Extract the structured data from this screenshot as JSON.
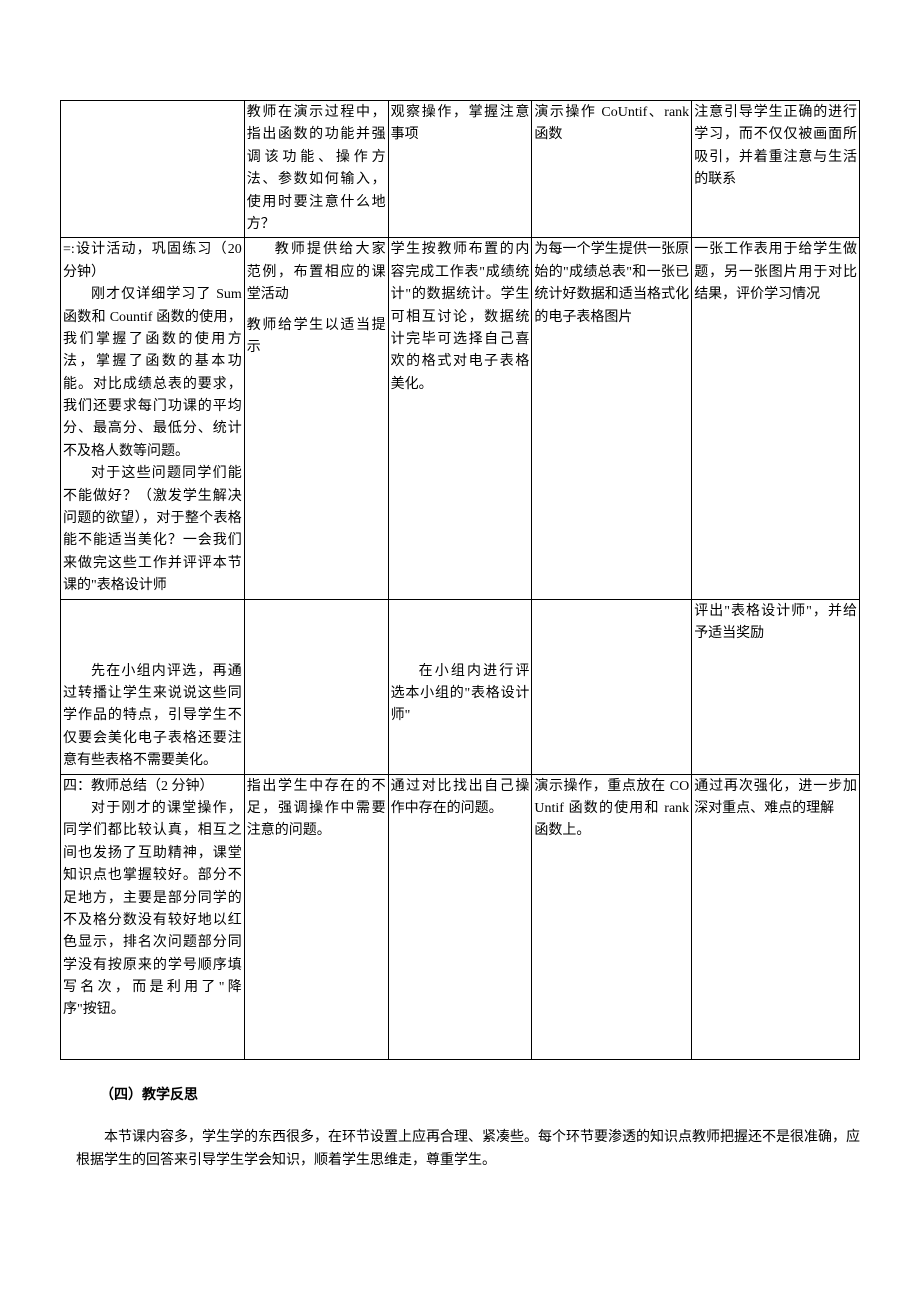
{
  "table": {
    "row1": {
      "c1": "",
      "c2": "教师在演示过程中，指出函数的功能并强调该功能、操作方法、参数如何输入，使用时要注意什么地方？",
      "c3": "观察操作，掌握注意事项",
      "c4": "演示操作 CoUntif、rank函数",
      "c5": "注意引导学生正确的进行学习，而不仅仅被画面所吸引，并着重注意与生活的联系"
    },
    "row2": {
      "c1_head": "=:设计活动，巩固练习（20 分钟）",
      "c1_p1": "刚才仅详细学习了 Sum函数和 Countif 函数的使用，我们掌握了函数的使用方法，掌握了函数的基本功能。对比成绩总表的要求，我们还要求每门功课的平均分、最高分、最低分、统计不及格人数等问题。",
      "c1_p2": "对于这些问题同学们能不能做好？（激发学生解决问题的欲望），对于整个表格能不能适当美化？一会我们来做完这些工作并评评本节课的\"表格设计师",
      "c2_p1": "教师提供给大家范例，布置相应的课堂活动",
      "c2_p2": "教师给学生以适当提示",
      "c3": "学生按教师布置的内容完成工作表\"成绩统计\"的数据统计。学生可相互讨论，数据统计完毕可选择自己喜欢的格式对电子表格美化。",
      "c4": "为每一个学生提供一张原始的\"成绩总表\"和一张已统计好数据和适当格式化的电子表格图片",
      "c5": "一张工作表用于给学生做题，另一张图片用于对比结果，评价学习情况"
    },
    "row3": {
      "c1": "先在小组内评选，再通过转播让学生来说说这些同学作品的特点，引导学生不仅要会美化电子表格还要注意有些表格不需要美化。",
      "c2": "",
      "c3": "在小组内进行评选本小组的\"表格设计师\"",
      "c4": "",
      "c5": "评出\"表格设计师\"，并给予适当奖励"
    },
    "row4": {
      "c1_head": "四：教师总结（2 分钟）",
      "c1_p1": "对于刚才的课堂操作，同学们都比较认真，相互之间也发扬了互助精神，课堂知识点也掌握较好。部分不足地方，主要是部分同学的不及格分数没有较好地以红色显示，排名次问题部分同学没有按原来的学号顺序填写名次，而是利用了\"降序\"按钮。",
      "c2": "指出学生中存在的不足，强调操作中需要注意的问题。",
      "c3": "通过对比找出自己操作中存在的问题。",
      "c4": "演示操作，重点放在 COUntif 函数的使用和 rank 函数上。",
      "c5": "通过再次强化，进一步加深对重点、难点的理解"
    }
  },
  "section_heading": "（四）教学反思",
  "reflection": "本节课内容多，学生学的东西很多，在环节设置上应再合理、紧凑些。每个环节要渗透的知识点教师把握还不是很准确，应根据学生的回答来引导学生学会知识，顺着学生思维走，尊重学生。"
}
